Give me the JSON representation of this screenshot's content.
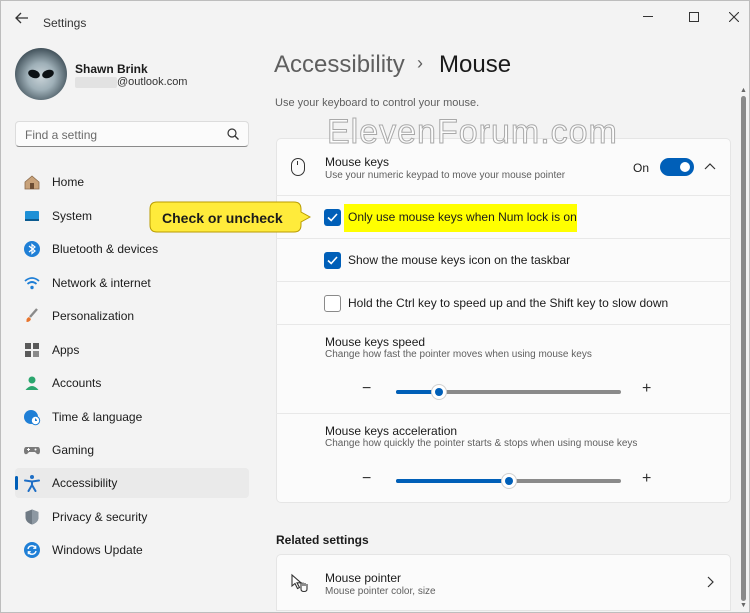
{
  "window": {
    "title": "Settings"
  },
  "profile": {
    "name": "Shawn Brink",
    "email": "@outlook.com"
  },
  "search": {
    "placeholder": "Find a setting"
  },
  "nav": [
    {
      "label": "Home",
      "icon": "home-icon"
    },
    {
      "label": "System",
      "icon": "system-icon"
    },
    {
      "label": "Bluetooth & devices",
      "icon": "bluetooth-icon"
    },
    {
      "label": "Network & internet",
      "icon": "wifi-icon"
    },
    {
      "label": "Personalization",
      "icon": "brush-icon"
    },
    {
      "label": "Apps",
      "icon": "apps-icon"
    },
    {
      "label": "Accounts",
      "icon": "person-icon"
    },
    {
      "label": "Time & language",
      "icon": "globe-clock-icon"
    },
    {
      "label": "Gaming",
      "icon": "gamepad-icon"
    },
    {
      "label": "Accessibility",
      "icon": "accessibility-icon",
      "active": true
    },
    {
      "label": "Privacy & security",
      "icon": "shield-icon"
    },
    {
      "label": "Windows Update",
      "icon": "update-icon"
    }
  ],
  "header": {
    "parent": "Accessibility",
    "current": "Mouse",
    "separator": "›"
  },
  "description": "Use your keyboard to control your mouse.",
  "watermark": "ElevenForum.com",
  "mouse_keys": {
    "title": "Mouse keys",
    "subtitle": "Use your numeric keypad to move your mouse pointer",
    "toggle_label": "On",
    "toggle_on": true
  },
  "options": [
    {
      "label": "Only use mouse keys when Num lock is on",
      "checked": true
    },
    {
      "label": "Show the mouse keys icon on the taskbar",
      "checked": true
    },
    {
      "label": "Hold the Ctrl key to speed up and the Shift key to slow down",
      "checked": false
    }
  ],
  "callout": {
    "text": "Check or uncheck"
  },
  "speed": {
    "title": "Mouse keys speed",
    "subtitle": "Change how fast the pointer moves when using mouse keys",
    "value": 0.19
  },
  "acceleration": {
    "title": "Mouse keys acceleration",
    "subtitle": "Change how quickly the pointer starts & stops when using mouse keys",
    "value": 0.5
  },
  "related": {
    "heading": "Related settings",
    "items": [
      {
        "title": "Mouse pointer",
        "subtitle": "Mouse pointer color, size"
      }
    ]
  },
  "colors": {
    "accent": "#005fb8",
    "highlight": "#ffff00",
    "callout": "#ffeb3b"
  }
}
